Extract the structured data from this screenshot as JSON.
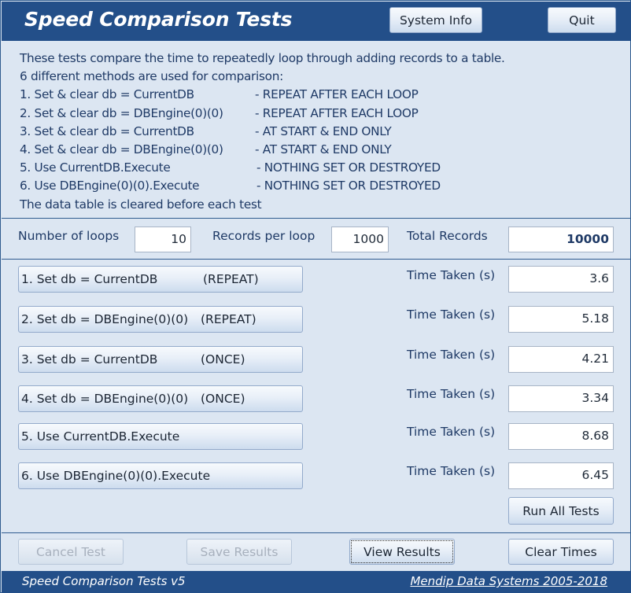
{
  "header": {
    "title": "Speed Comparison Tests",
    "system_info_label": "System Info",
    "quit_label": "Quit"
  },
  "intro": {
    "line1": "These tests compare the time to repeatedly loop through adding records to a table.",
    "line2": "6 different methods are used for comparison:",
    "methods": [
      {
        "name": "1. Set & clear db = CurrentDB",
        "note": "- REPEAT AFTER EACH LOOP"
      },
      {
        "name": "2. Set & clear db = DBEngine(0)(0)",
        "note": "- REPEAT AFTER EACH LOOP"
      },
      {
        "name": "3. Set & clear db = CurrentDB",
        "note": "- AT START & END ONLY"
      },
      {
        "name": "4. Set & clear db = DBEngine(0)(0)",
        "note": "- AT START & END ONLY"
      },
      {
        "name": "5. Use CurrentDB.Execute",
        "note": "- NOTHING SET OR DESTROYED"
      },
      {
        "name": "6. Use DBEngine(0)(0).Execute",
        "note": "- NOTHING SET OR DESTROYED"
      }
    ],
    "last_line": "The data table is cleared before each test"
  },
  "settings": {
    "loops_label": "Number of loops",
    "loops_value": "10",
    "records_label": "Records per loop",
    "records_value": "1000",
    "total_label": "Total Records",
    "total_value": "10000"
  },
  "tests": [
    {
      "label": "1. Set db = CurrentDB",
      "mode": "(REPEAT)",
      "time_label": "Time Taken (s)",
      "time": "3.6"
    },
    {
      "label": "2. Set db = DBEngine(0)(0)",
      "mode": "(REPEAT)",
      "time_label": "Time Taken (s)",
      "time": "5.18"
    },
    {
      "label": "3. Set db = CurrentDB",
      "mode": "(ONCE)",
      "time_label": "Time Taken (s)",
      "time": "4.21"
    },
    {
      "label": "4. Set db = DBEngine(0)(0)",
      "mode": "(ONCE)",
      "time_label": "Time Taken (s)",
      "time": "3.34"
    },
    {
      "label": "5. Use CurrentDB.Execute",
      "mode": "",
      "time_label": "Time Taken (s)",
      "time": "8.68"
    },
    {
      "label": "6. Use DBEngine(0)(0).Execute",
      "mode": "",
      "time_label": "Time Taken (s)",
      "time": "6.45"
    }
  ],
  "run_all_label": "Run All Tests",
  "bottom": {
    "cancel_label": "Cancel Test",
    "save_label": "Save Results",
    "view_label": "View Results",
    "clear_label": "Clear Times"
  },
  "footer": {
    "version": "Speed Comparison Tests v5",
    "copyright": "Mendip Data Systems 2005-2018"
  },
  "colors": {
    "header_bg": "#234f89",
    "panel_bg": "#dce6f2",
    "label_text": "#1f3a66"
  }
}
